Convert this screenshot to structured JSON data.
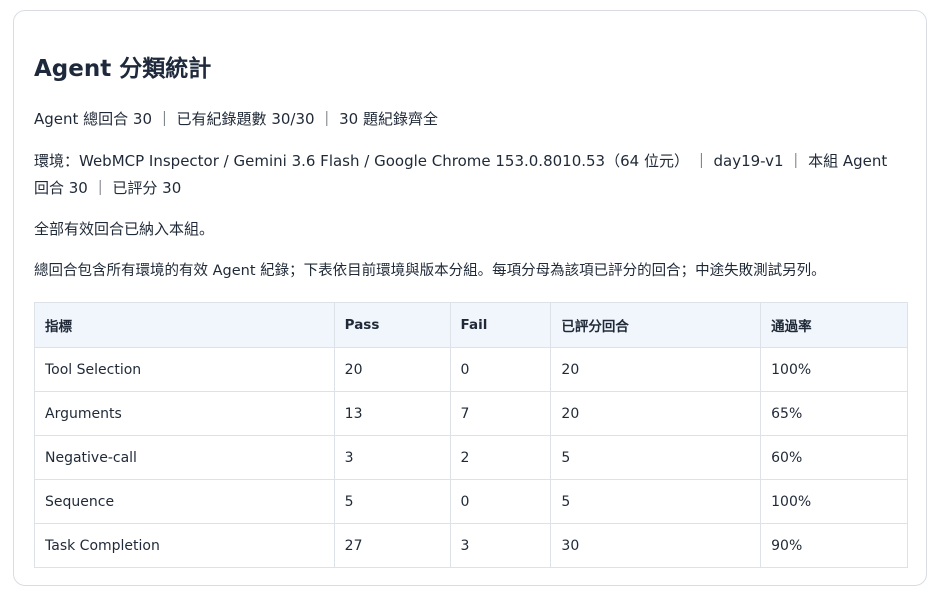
{
  "panel": {
    "title": "Agent 分類統計",
    "summary": "Agent 總回合 30 ｜ 已有紀錄題數 30/30 ｜ 30 題紀錄齊全",
    "environment_line1": "環境：WebMCP Inspector / Gemini 3.6 Flash / Google Chrome 153.0.8010.53（64 位元） ｜ day19-v1 ｜ 本組 Agent",
    "environment_line2": "回合 30 ｜ 已評分 30",
    "note_included": "全部有效回合已納入本組。",
    "note_explanation": "總回合包含所有環境的有效 Agent 紀錄；下表依目前環境與版本分組。每項分母為該項已評分的回合；中途失敗測試另列。"
  },
  "table": {
    "headers": {
      "metric": "指標",
      "pass": "Pass",
      "fail": "Fail",
      "scored": "已評分回合",
      "rate": "通過率"
    },
    "rows": [
      {
        "metric": "Tool Selection",
        "pass": "20",
        "fail": "0",
        "scored": "20",
        "rate": "100%"
      },
      {
        "metric": "Arguments",
        "pass": "13",
        "fail": "7",
        "scored": "20",
        "rate": "65%"
      },
      {
        "metric": "Negative-call",
        "pass": "3",
        "fail": "2",
        "scored": "5",
        "rate": "60%"
      },
      {
        "metric": "Sequence",
        "pass": "5",
        "fail": "0",
        "scored": "5",
        "rate": "100%"
      },
      {
        "metric": "Task Completion",
        "pass": "27",
        "fail": "3",
        "scored": "30",
        "rate": "90%"
      }
    ]
  },
  "colors": {
    "header_bg": "#f1f6fd",
    "border": "#dde2e8",
    "title": "#1e293b"
  }
}
